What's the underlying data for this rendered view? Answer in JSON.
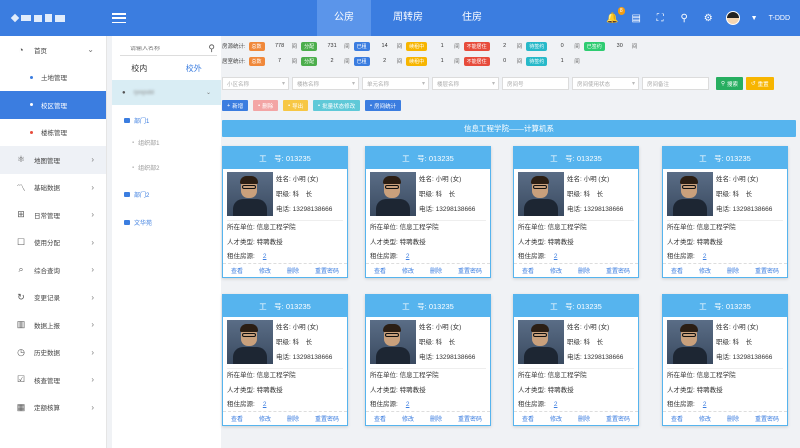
{
  "topbar": {
    "nav_tabs": [
      "公房",
      "周转房",
      "住房"
    ],
    "notification_count": "8",
    "username": "T-DDD"
  },
  "sidebar": {
    "items": [
      {
        "label": "首页",
        "icon": "gauge-icon"
      },
      {
        "label": "土地管理"
      },
      {
        "label": "校区管理"
      },
      {
        "label": "楼栋管理"
      },
      {
        "label": "地图管理",
        "icon": "globe-icon"
      },
      {
        "label": "基础数据",
        "icon": "chart-line-icon"
      },
      {
        "label": "日常管理",
        "icon": "grid-icon"
      },
      {
        "label": "使用分配",
        "icon": "square-icon"
      },
      {
        "label": "综合查询",
        "icon": "search-list-icon"
      },
      {
        "label": "变更记录",
        "icon": "refresh-icon"
      },
      {
        "label": "数据上报",
        "icon": "bar-chart-icon"
      },
      {
        "label": "历史数据",
        "icon": "clock-icon"
      },
      {
        "label": "核查管理",
        "icon": "doc-check-icon"
      },
      {
        "label": "定额核算",
        "icon": "calc-icon"
      }
    ]
  },
  "tree": {
    "search_placeholder": "请输入名称",
    "tabs": [
      "校内",
      "校外"
    ],
    "root": "rjxxjsdd",
    "nodes": [
      "部门1",
      "组织部1",
      "组织部2",
      "部门2",
      "文华苑"
    ]
  },
  "stats": {
    "row1_label": "房源统计:",
    "row2_label": "居室统计:",
    "row1": [
      {
        "tag": "总数",
        "value": "778",
        "unit": "间",
        "color": "#f0883a"
      },
      {
        "tag": "分配",
        "value": "731",
        "unit": "间",
        "color": "#4cae4c"
      },
      {
        "tag": "已租",
        "value": "14",
        "unit": "间",
        "color": "#3b7de0"
      },
      {
        "tag": "续租中",
        "value": "1",
        "unit": "间",
        "color": "#f7b500"
      },
      {
        "tag": "不能居住",
        "value": "2",
        "unit": "间",
        "color": "#e74c3c"
      },
      {
        "tag": "待签约",
        "value": "0",
        "unit": "间",
        "color": "#27b9c9"
      },
      {
        "tag": "已签约",
        "value": "30",
        "unit": "间",
        "color": "#2ecc71"
      }
    ],
    "row2": [
      {
        "tag": "总数",
        "value": "7",
        "unit": "间",
        "color": "#f0883a"
      },
      {
        "tag": "分配",
        "value": "2",
        "unit": "间",
        "color": "#4cae4c"
      },
      {
        "tag": "已租",
        "value": "2",
        "unit": "间",
        "color": "#3b7de0"
      },
      {
        "tag": "续租中",
        "value": "1",
        "unit": "间",
        "color": "#f7b500"
      },
      {
        "tag": "不能居住",
        "value": "0",
        "unit": "间",
        "color": "#e74c3c"
      },
      {
        "tag": "待签约",
        "value": "1",
        "unit": "间",
        "color": "#27b9c9"
      }
    ]
  },
  "filters": {
    "placeholders": [
      "小区名称",
      "楼栋名称",
      "单元名称",
      "楼层名称",
      "房间号",
      "房间使用状态",
      "房间备注"
    ],
    "search_button": "搜索",
    "reset_button": "重置"
  },
  "actions": [
    "新增",
    "删除",
    "导出",
    "批量状态修改",
    "房间统计"
  ],
  "banner": "信息工程学院——计算机系",
  "card": {
    "id_label": "工　号:",
    "id_value": "013235",
    "name": "姓名: 小明 (女)",
    "title": "职级: 科　长",
    "phone": "电话: 13298138666",
    "unit": "所在单位: 信息工程学院",
    "talent": "人才类型: 特聘教授",
    "rooms_label": "租住房源:",
    "rooms_value": "2",
    "actions": [
      "查看",
      "修改",
      "删除",
      "重置密码"
    ]
  }
}
